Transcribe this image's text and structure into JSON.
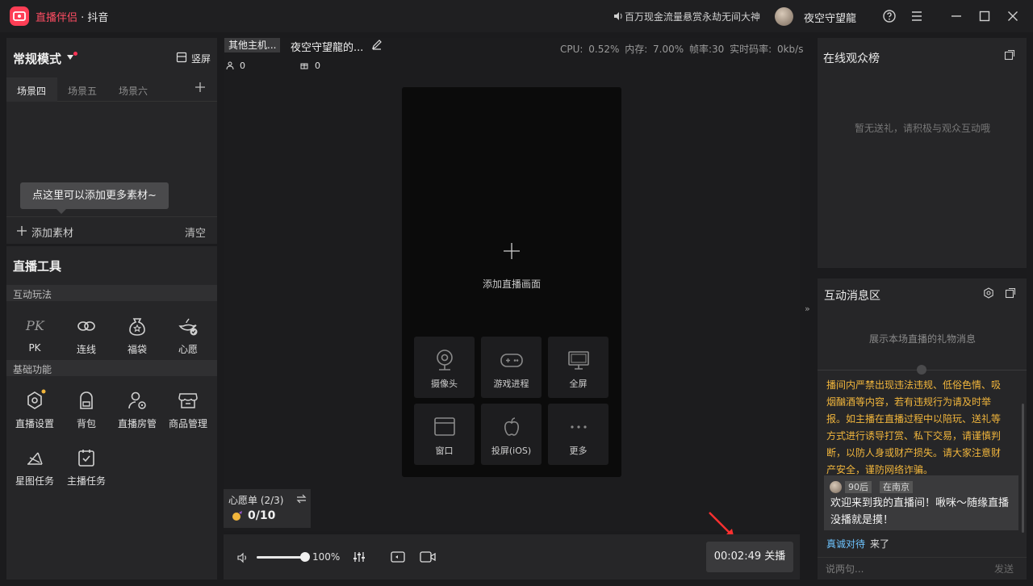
{
  "titlebar": {
    "app_name": "直播伴侣",
    "separator": " · ",
    "platform": "抖音",
    "notice": "百万现金流量悬赏永劫无间大神",
    "username": "夜空守望龍"
  },
  "left_panel": {
    "mode": "常规模式",
    "portrait_label": "竖屏",
    "scene_tabs": [
      "场景四",
      "场景五",
      "场景六"
    ],
    "tooltip": "点这里可以添加更多素材~",
    "add_material": "添加素材",
    "clear": "清空"
  },
  "tools": {
    "title": "直播工具",
    "interactive_section": "互动玩法",
    "interactive_items": [
      "PK",
      "连线",
      "福袋",
      "心愿"
    ],
    "basic_section": "基础功能",
    "basic_items": [
      "直播设置",
      "背包",
      "直播房管",
      "商品管理",
      "星图任务",
      "主播任务"
    ]
  },
  "stage": {
    "host_tag": "其他主机...",
    "room_name": "夜空守望龍的...",
    "stats": "CPU: 0.52%  内存: 7.00%  帧率:30  实时码率: 0kb/s",
    "viewers": "0",
    "gifts": "0",
    "add_live_label": "添加直播画面",
    "sources": [
      "摄像头",
      "游戏进程",
      "全屏",
      "窗口",
      "投屏(iOS)",
      "更多"
    ],
    "wishlist_title": "心愿单 (2/3)",
    "wishlist_count": "0/10"
  },
  "bottom_bar": {
    "volume_label": "100%",
    "volume_level": 1.0,
    "timer": "00:02:49 关播"
  },
  "right_panel": {
    "audience_title": "在线观众榜",
    "audience_empty": "暂无送礼，请积极与观众互动哦",
    "messages_title": "互动消息区",
    "gift_placeholder": "展示本场直播的礼物消息",
    "notice": "播间内严禁出现违法违规、低俗色情、吸烟酗酒等内容，若有违规行为请及时举报。如主播在直播过程中以陪玩、送礼等方式进行诱导打赏、私下交易，请谨慎判断，以防人身或财产损失。请大家注意财产安全，谨防网络诈骗。",
    "badge_age": "90后",
    "badge_location": "在南京",
    "welcome": "欢迎来到我的直播间！啾咪～随缘直播没播就是摸！",
    "visitor_name": "真诚对待",
    "visitor_action": "来了",
    "chat_placeholder": "说两句...",
    "send": "发送"
  }
}
